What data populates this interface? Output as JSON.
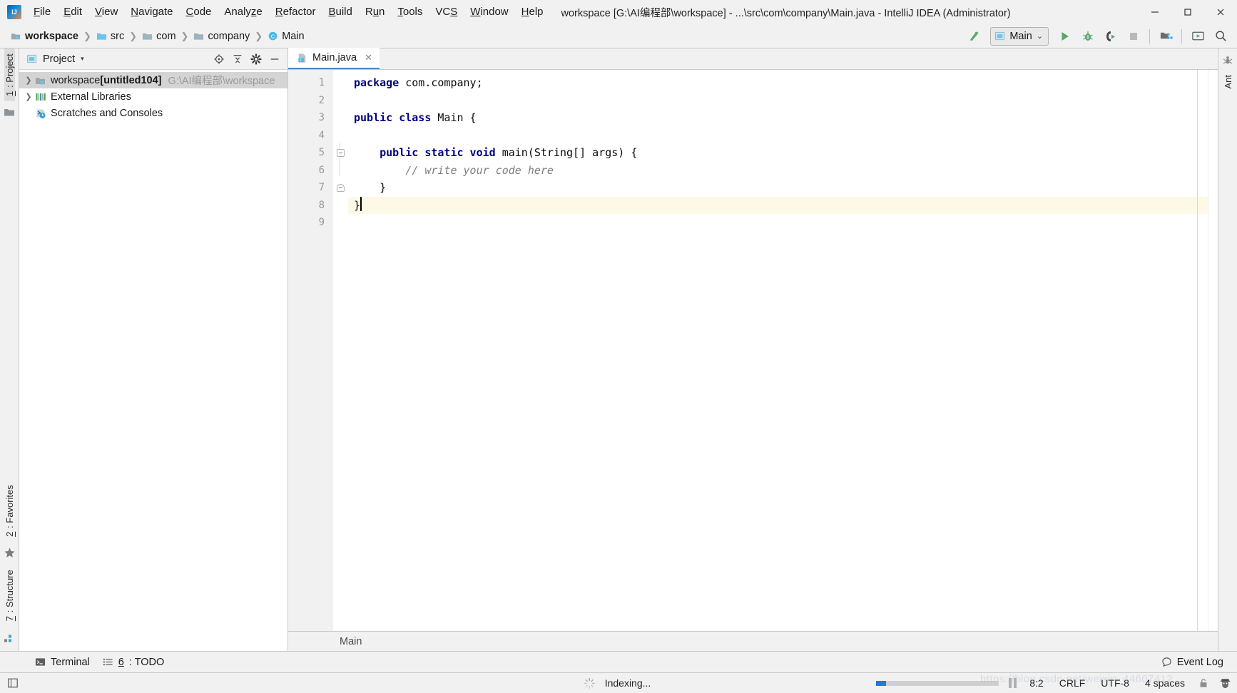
{
  "window": {
    "title": "workspace [G:\\AI编程部\\workspace] - ...\\src\\com\\company\\Main.java - IntelliJ IDEA (Administrator)",
    "logo_text": "IJ",
    "minimize": "—",
    "maximize": "☐",
    "close": "✕"
  },
  "menubar": {
    "items": [
      {
        "pre": "",
        "mn": "F",
        "post": "ile"
      },
      {
        "pre": "",
        "mn": "E",
        "post": "dit"
      },
      {
        "pre": "",
        "mn": "V",
        "post": "iew"
      },
      {
        "pre": "",
        "mn": "N",
        "post": "avigate"
      },
      {
        "pre": "",
        "mn": "C",
        "post": "ode"
      },
      {
        "pre": "Analy",
        "mn": "z",
        "post": "e"
      },
      {
        "pre": "",
        "mn": "R",
        "post": "efactor"
      },
      {
        "pre": "",
        "mn": "B",
        "post": "uild"
      },
      {
        "pre": "R",
        "mn": "u",
        "post": "n"
      },
      {
        "pre": "",
        "mn": "T",
        "post": "ools"
      },
      {
        "pre": "VC",
        "mn": "S",
        "post": ""
      },
      {
        "pre": "",
        "mn": "W",
        "post": "indow"
      },
      {
        "pre": "",
        "mn": "H",
        "post": "elp"
      }
    ]
  },
  "breadcrumbs": {
    "separator": "❯",
    "items": [
      {
        "label": "workspace",
        "icon": "module-icon",
        "bold": true
      },
      {
        "label": "src",
        "icon": "source-folder-icon",
        "bold": false
      },
      {
        "label": "com",
        "icon": "folder-icon",
        "bold": false
      },
      {
        "label": "company",
        "icon": "folder-icon",
        "bold": false
      },
      {
        "label": "Main",
        "icon": "java-class-icon",
        "bold": false
      }
    ]
  },
  "toolbar": {
    "build_hammer": "build-icon",
    "run_config_label": "Main",
    "run_config_caret": "⌄",
    "run_button": "run-icon",
    "debug_button": "debug-icon",
    "run_with_coverage_button": "run-coverage-icon",
    "stop_button": "stop-icon",
    "project_structure_button": "project-structure-icon",
    "updates_button": "updates-icon",
    "search_everywhere_button": "search-icon"
  },
  "left_stripe": {
    "top": [
      {
        "label_pre": "",
        "label_mn": "1",
        "label_post": ": Project",
        "selected": true
      }
    ],
    "bottom": [
      {
        "label_pre": "",
        "label_mn": "2",
        "label_post": ": Favorites",
        "selected": false
      },
      {
        "label_pre": "",
        "label_mn": "7",
        "label_post": ": Structure",
        "selected": false
      }
    ]
  },
  "right_stripe": {
    "items": [
      {
        "label": "Ant",
        "icon": "ant-icon"
      }
    ]
  },
  "project_panel": {
    "title": "Project",
    "caret": "▾",
    "actions": [
      "locate-icon",
      "collapse-all-icon",
      "settings-gear-icon",
      "hide-icon"
    ],
    "tree": [
      {
        "arrow": "❯",
        "icon": "module-icon",
        "label": "workspace ",
        "bold_label": "[untitled104]",
        "path": "G:\\AI编程部\\workspace",
        "selected": true,
        "indent": 0
      },
      {
        "arrow": "❯",
        "icon": "library-icon",
        "label": "External Libraries",
        "bold_label": "",
        "path": "",
        "selected": false,
        "indent": 0
      },
      {
        "arrow": "",
        "icon": "scratches-icon",
        "label": "Scratches and Consoles",
        "bold_label": "",
        "path": "",
        "selected": false,
        "indent": 0
      }
    ]
  },
  "editor": {
    "tabs": [
      {
        "label": "Main.java",
        "icon": "java-file-icon",
        "close": "✕",
        "active": true
      }
    ],
    "line_numbers": [
      "1",
      "2",
      "3",
      "4",
      "5",
      "6",
      "7",
      "8",
      "9"
    ],
    "lines": [
      {
        "n": 1,
        "tokens": [
          {
            "t": "package",
            "c": "kw"
          },
          {
            "t": " com.company;",
            "c": ""
          }
        ],
        "highlight": false,
        "fold": ""
      },
      {
        "n": 2,
        "tokens": [
          {
            "t": "",
            "c": ""
          }
        ],
        "highlight": false,
        "fold": ""
      },
      {
        "n": 3,
        "tokens": [
          {
            "t": "public class",
            "c": "kw"
          },
          {
            "t": " Main {",
            "c": ""
          }
        ],
        "highlight": false,
        "fold": ""
      },
      {
        "n": 4,
        "tokens": [
          {
            "t": "",
            "c": ""
          }
        ],
        "highlight": false,
        "fold": ""
      },
      {
        "n": 5,
        "tokens": [
          {
            "t": "    ",
            "c": ""
          },
          {
            "t": "public static void",
            "c": "kw"
          },
          {
            "t": " main(String[] args) {",
            "c": ""
          }
        ],
        "highlight": false,
        "fold": "open"
      },
      {
        "n": 6,
        "tokens": [
          {
            "t": "        ",
            "c": ""
          },
          {
            "t": "// write your code here",
            "c": "cm"
          }
        ],
        "highlight": false,
        "fold": ""
      },
      {
        "n": 7,
        "tokens": [
          {
            "t": "    }",
            "c": ""
          }
        ],
        "highlight": false,
        "fold": "close"
      },
      {
        "n": 8,
        "tokens": [
          {
            "t": "}",
            "c": ""
          }
        ],
        "highlight": true,
        "fold": ""
      },
      {
        "n": 9,
        "tokens": [
          {
            "t": "",
            "c": ""
          }
        ],
        "highlight": false,
        "fold": ""
      }
    ],
    "breadcrumb_footer": "Main"
  },
  "bottom_toolwindows": {
    "left": [
      {
        "icon": "terminal-icon",
        "pre": "",
        "mn": "",
        "post": "Terminal"
      },
      {
        "icon": "todo-icon",
        "pre": "",
        "mn": "6",
        "post": ": TODO"
      }
    ],
    "right": [
      {
        "icon": "event-log-icon",
        "label": "Event Log"
      }
    ]
  },
  "statusbar": {
    "left_icon": "show-tool-windows-icon",
    "indexing_label": "Indexing...",
    "indexing_icon": "spinner-icon",
    "progress_percent": 8,
    "pause_icon": "pause-icon",
    "caret_position": "8:2",
    "line_separator": "CRLF",
    "encoding": "UTF-8",
    "indent": "4 spaces",
    "lock_icon": "unlock-icon",
    "face_icon": "inspector-face-icon",
    "watermark": "https://blog.csdn.net/weixin_44607412"
  },
  "colors": {
    "accent_blue": "#4a86c8",
    "keyword_navy": "#000080",
    "comment_gray": "#808080",
    "line_highlight": "#fdf9e6",
    "selection_gray": "#d4d4d4",
    "chrome_gray": "#f1f1f1",
    "run_green": "#59a869",
    "progress_blue": "#2a76d2"
  }
}
